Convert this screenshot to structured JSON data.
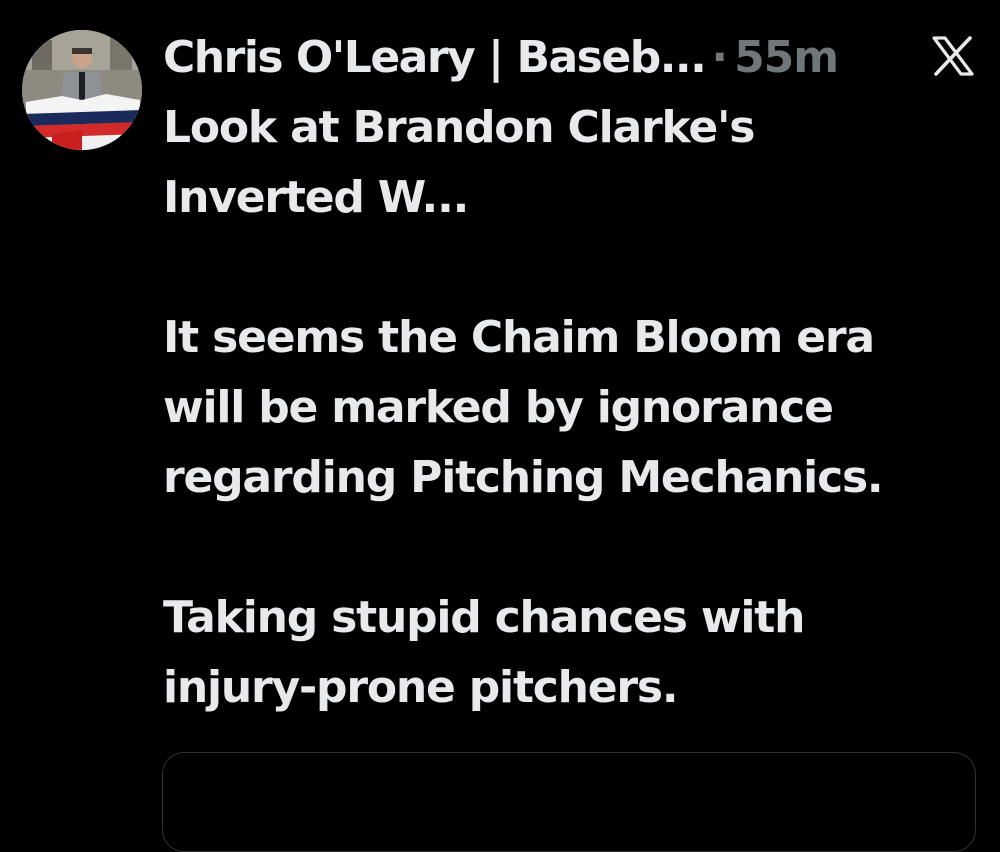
{
  "post": {
    "author_display": "Chris O'Leary | Baseb...",
    "separator": "·",
    "time_ago": "55m",
    "platform_icon": "x-logo-icon",
    "lines": [
      "Look at Brandon Clarke's",
      "Inverted W...",
      "",
      "It seems the Chaim Bloom era",
      "will be marked by ignorance",
      "regarding Pitching Mechanics.",
      "",
      "Taking stupid chances with",
      "injury-prone pitchers."
    ]
  },
  "colors": {
    "background": "#000000",
    "text": "#e7e9ea",
    "secondary": "#71767b",
    "border": "#2f3336"
  }
}
